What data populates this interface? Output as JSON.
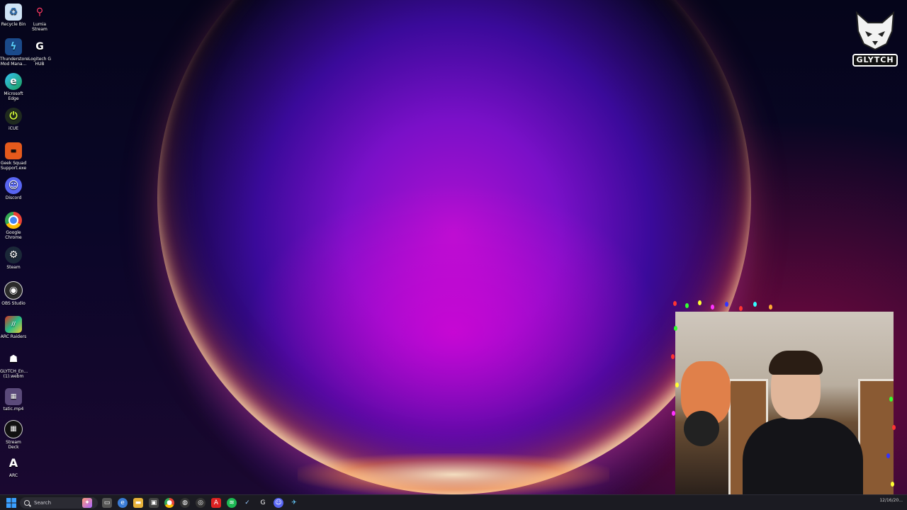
{
  "desktop": {
    "icons": [
      {
        "label": "Recycle Bin",
        "icon": "recycle-bin-icon"
      },
      {
        "label": "Lumia Stream",
        "icon": "lumia-stream-icon"
      },
      {
        "label": "Thunderstore Mod Mana...",
        "icon": "thunderstore-icon"
      },
      {
        "label": "Logitech G HUB",
        "icon": "logitech-g-hub-icon"
      },
      {
        "label": "Microsoft Edge",
        "icon": "edge-icon"
      },
      {
        "label": "iCUE",
        "icon": "icue-icon"
      },
      {
        "label": "Geek Squad Support.exe",
        "icon": "geek-squad-icon"
      },
      {
        "label": "Discord",
        "icon": "discord-icon"
      },
      {
        "label": "Google Chrome",
        "icon": "chrome-icon"
      },
      {
        "label": "Steam",
        "icon": "steam-icon"
      },
      {
        "label": "OBS Studio",
        "icon": "obs-icon"
      },
      {
        "label": "ARC Raiders",
        "icon": "arc-raiders-icon"
      },
      {
        "label": "GLYTCH_En... (1).webm",
        "icon": "webm-file-icon"
      },
      {
        "label": "tatic.mp4",
        "icon": "mp4-file-icon"
      },
      {
        "label": "Stream Deck",
        "icon": "stream-deck-icon"
      },
      {
        "label": "ARC",
        "icon": "arc-icon"
      }
    ]
  },
  "overlay": {
    "logo_text": "GLYTCH"
  },
  "taskbar": {
    "search_placeholder": "Search",
    "pinned": [
      "file-explorer-icon",
      "task-view-icon",
      "copilot-icon",
      "folder-icon",
      "store-icon",
      "chrome-icon",
      "app-icon",
      "app-icon-2",
      "arc-raiders-icon",
      "spotify-icon",
      "steam-icon",
      "logitech-icon",
      "discord-icon",
      "app-icon-3"
    ],
    "clock_time": "",
    "clock_date": "12/16/20..."
  },
  "colors": {
    "taskbar_bg": "#1b1b22",
    "wallpaper_accent": "#b010d0"
  }
}
